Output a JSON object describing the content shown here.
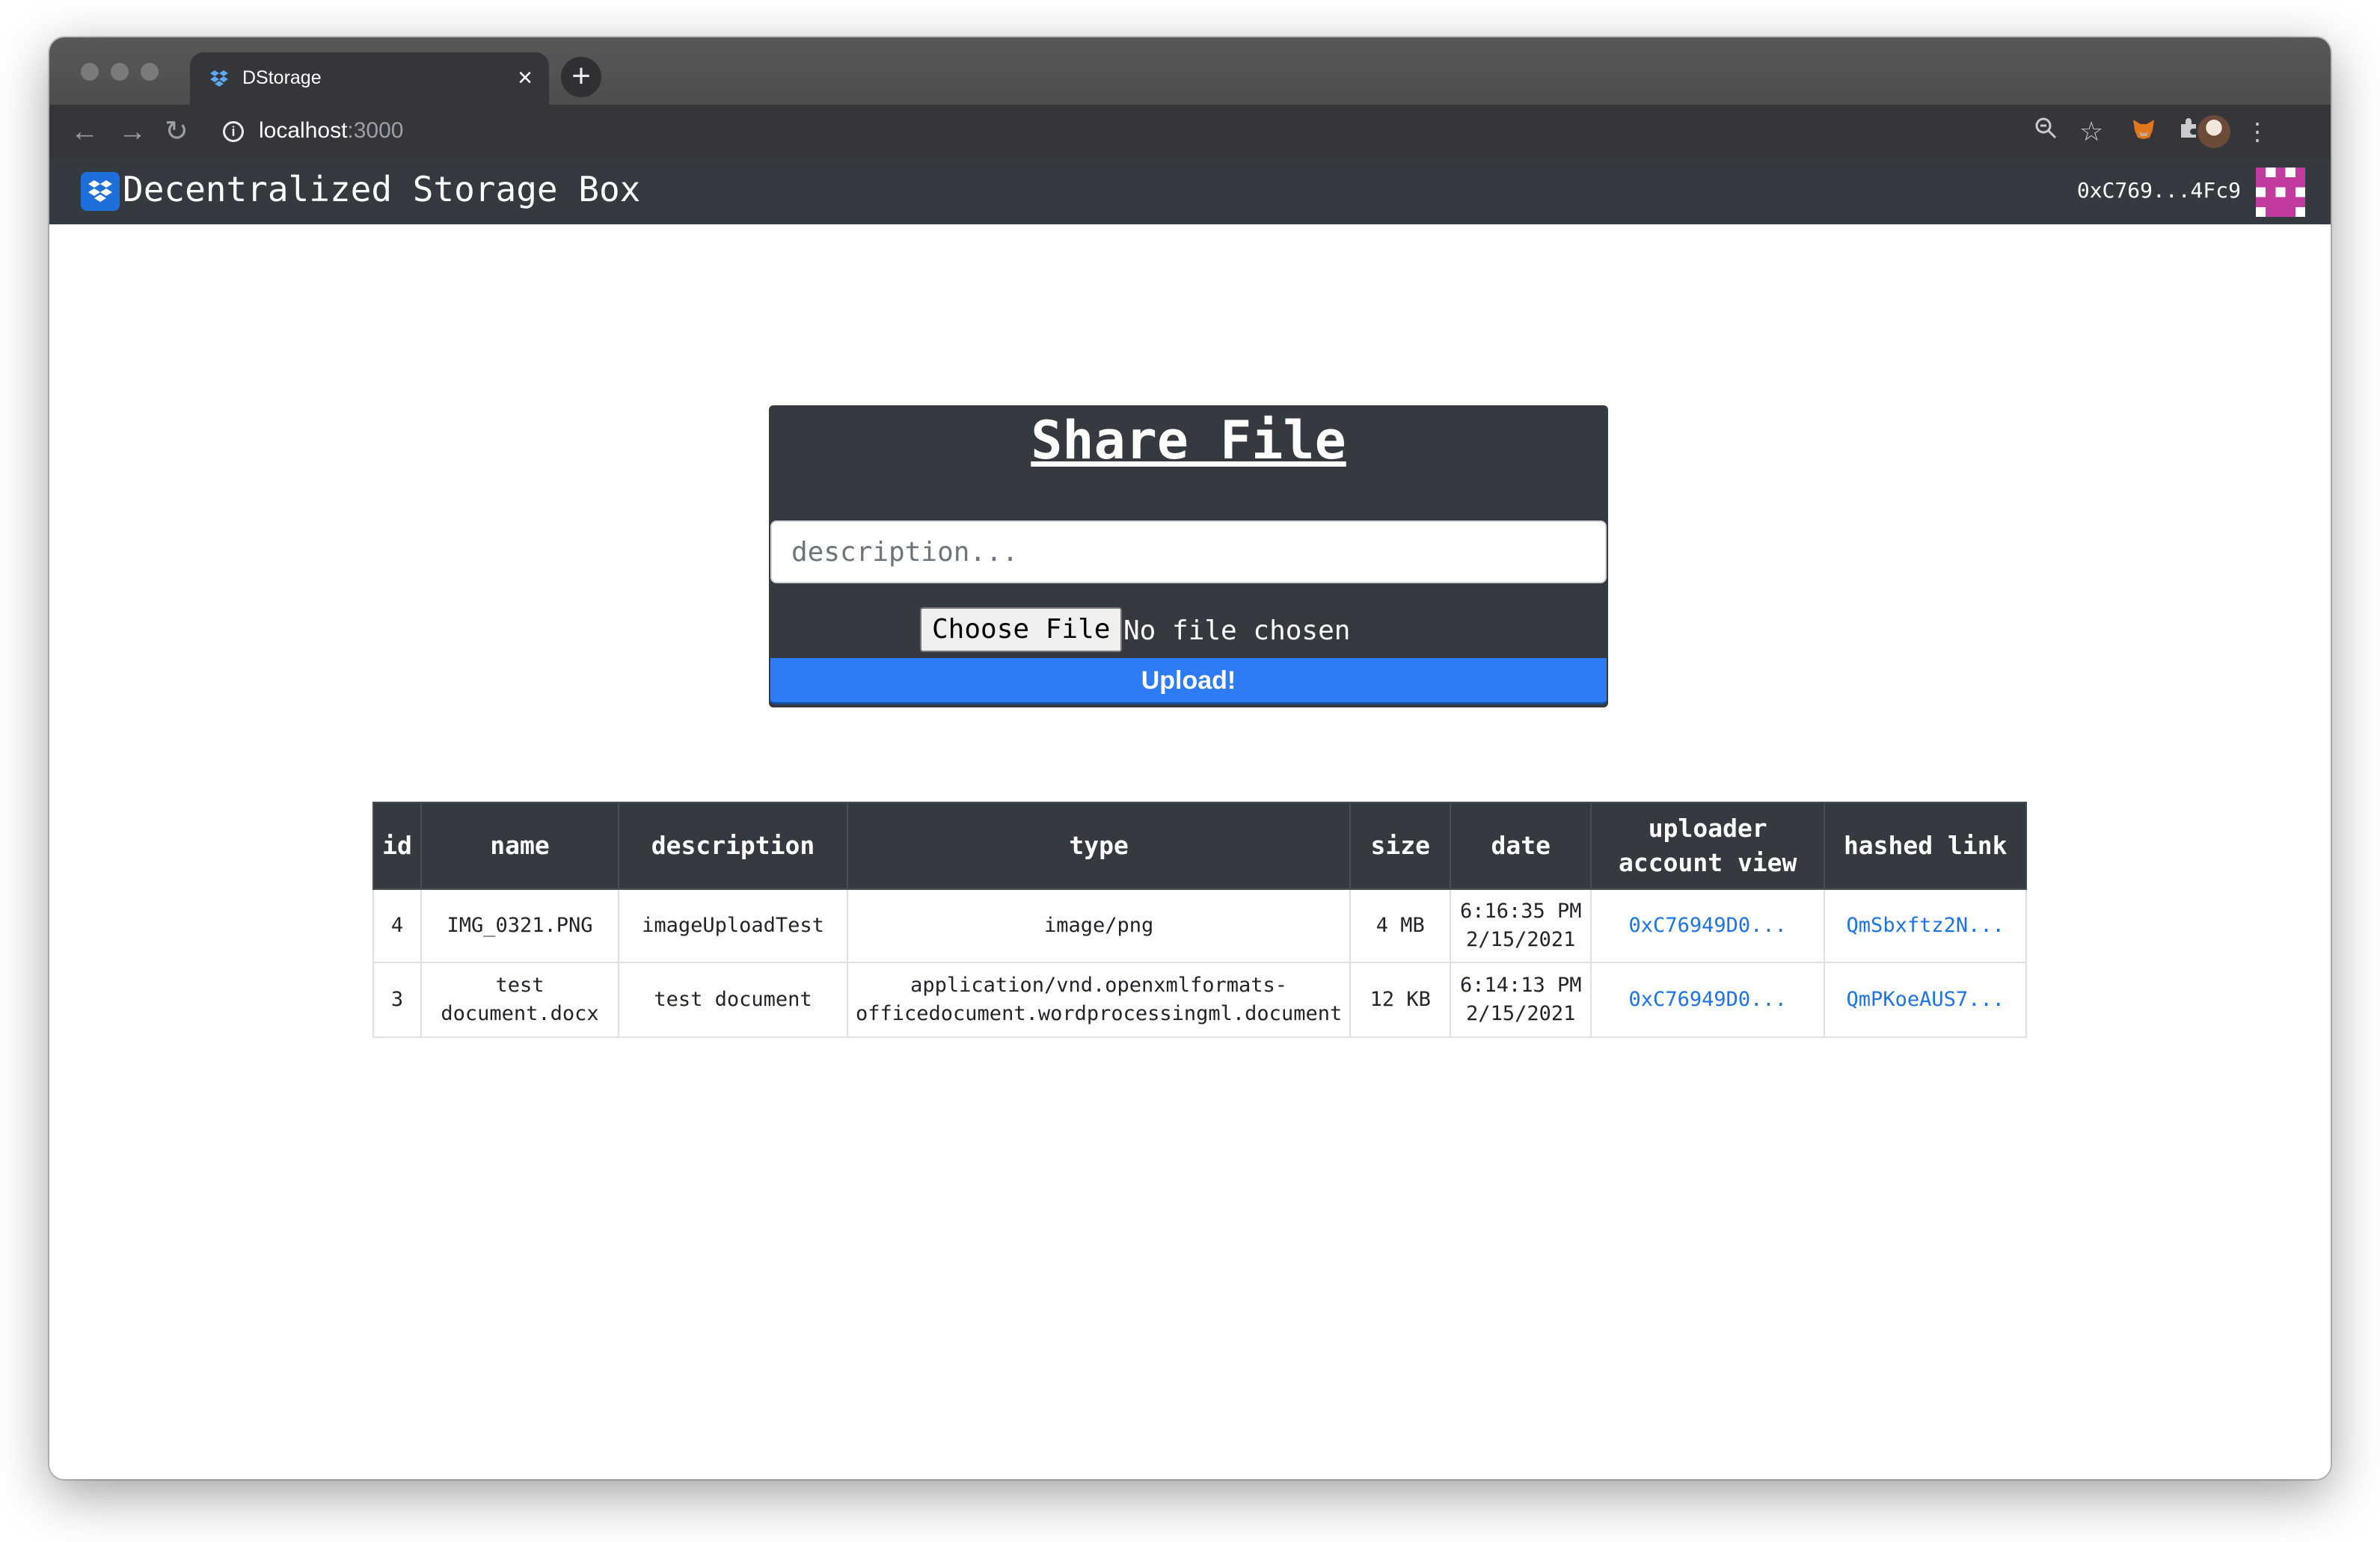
{
  "browser": {
    "tab_title": "DStorage",
    "tab_close": "×",
    "new_tab": "+",
    "url_host": "localhost",
    "url_port": ":3000",
    "icons": [
      "back-icon",
      "forward-icon",
      "reload-icon",
      "site-info-icon",
      "zoom-icon",
      "bookmark-star-icon",
      "metamask-icon",
      "extensions-icon",
      "profile-avatar",
      "menu-icon"
    ]
  },
  "navbar": {
    "brand": "Decentralized Storage Box",
    "account": "0xC769...4Fc9"
  },
  "share_form": {
    "title": "Share File",
    "description_placeholder": "description...",
    "choose_file_label": "Choose File",
    "file_status": "No file chosen",
    "upload_label": "Upload!"
  },
  "table": {
    "headers": {
      "id": "id",
      "name": "name",
      "description": "description",
      "type": "type",
      "size": "size",
      "date": "date",
      "uploader_1": "uploader",
      "uploader_2": "account view",
      "hashed_link": "hashed link"
    },
    "rows": [
      {
        "id": "4",
        "name_1": "IMG_0321.PNG",
        "name_2": "",
        "description": "imageUploadTest",
        "type_1": "image/png",
        "type_2": "",
        "size": "4 MB",
        "time": "6:16:35 PM",
        "date": "2/15/2021",
        "uploader": "0xC76949D0...",
        "hash": "QmSbxftz2N..."
      },
      {
        "id": "3",
        "name_1": "test",
        "name_2": "document.docx",
        "description": "test document",
        "type_1": "application/vnd.openxmlformats-",
        "type_2": "officedocument.wordprocessingml.document",
        "size": "12 KB",
        "time": "6:14:13 PM",
        "date": "2/15/2021",
        "uploader": "0xC76949D0...",
        "hash": "QmPKoeAUS7..."
      }
    ]
  },
  "colors": {
    "navbar": "#343a40",
    "upload_button": "#2d7cf6",
    "link": "#1a73e8"
  }
}
